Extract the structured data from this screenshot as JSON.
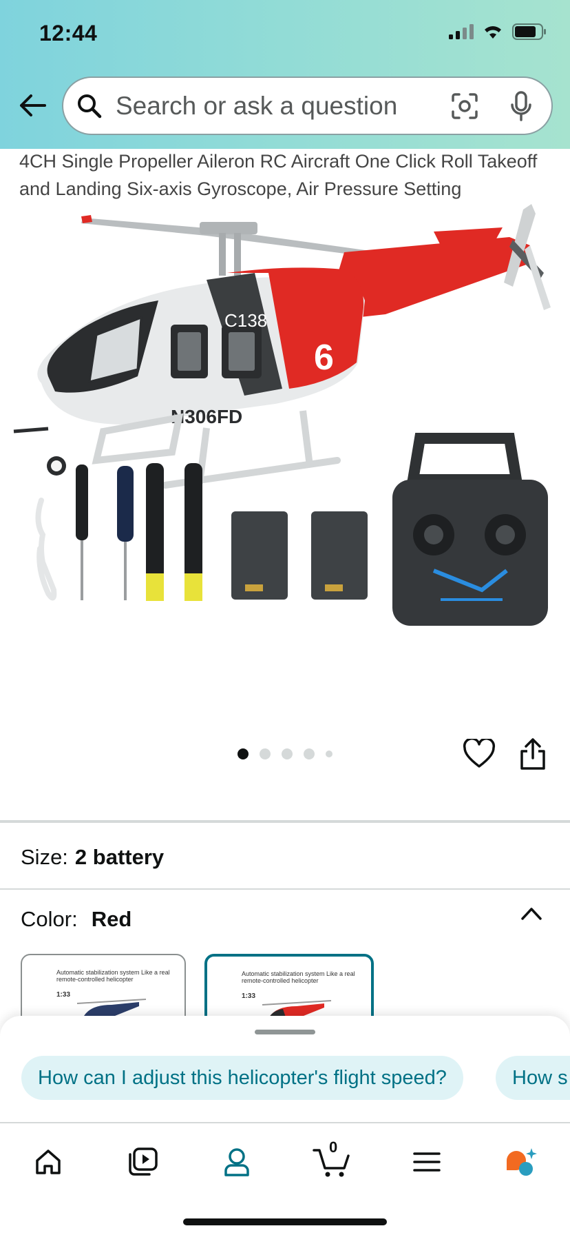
{
  "status_bar": {
    "time": "12:44"
  },
  "search": {
    "placeholder": "Search or ask a question"
  },
  "product": {
    "title": "4CH Single Propeller Aileron RC Aircraft One Click Roll Takeoff and Landing Six-axis Gyroscope, Air Pressure Setting",
    "image": {
      "alt": "RC helicopter with controller, batteries, blades and accessories",
      "tail_text": "C138",
      "door_number": "6",
      "registration": "N306FD"
    },
    "carousel": {
      "total_dots": 5,
      "active_index": 0
    }
  },
  "size": {
    "label": "Size:",
    "value": "2 battery"
  },
  "color": {
    "label": "Color:",
    "value": "Red",
    "swatches": [
      {
        "caption": "Automatic stabilization system Like a real remote-controlled helicopter",
        "scale": "1:33",
        "selected": false
      },
      {
        "caption": "Automatic stabilization system Like a real remote-controlled helicopter",
        "scale": "1:33",
        "selected": true
      }
    ]
  },
  "suggestions": [
    "How can I adjust this helicopter's flight speed?",
    "How s"
  ],
  "tabbar": {
    "cart_count": "0",
    "items": [
      "home-icon",
      "video-icon",
      "account-icon",
      "cart-icon",
      "menu-icon",
      "rufus-icon"
    ]
  },
  "colors": {
    "accent": "#007185",
    "header_from": "#7fd3dd",
    "header_to": "#a6e3cf",
    "chip_bg": "#dff3f6",
    "heli_red": "#e02a24"
  }
}
